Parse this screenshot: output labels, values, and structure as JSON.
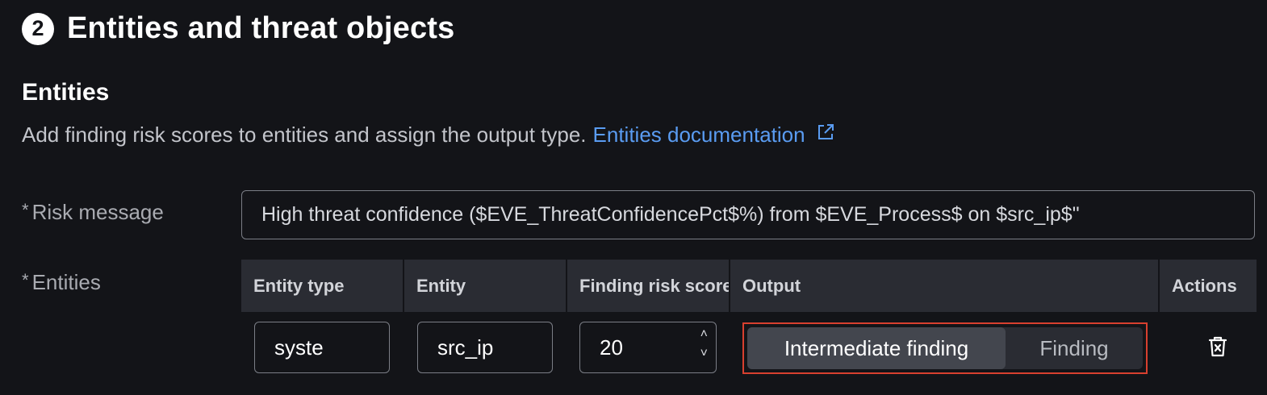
{
  "step": {
    "number": "2",
    "title": "Entities and threat objects"
  },
  "section": {
    "title": "Entities",
    "description": "Add finding risk scores to entities and assign the output type.",
    "doc_link": "Entities documentation",
    "doc_link_icon": "external-link-icon"
  },
  "risk_message": {
    "required_mark": "*",
    "label": "Risk message",
    "value": "High threat confidence ($EVE_ThreatConfidencePct$%) from $EVE_Process$ on $src_ip$\""
  },
  "entities": {
    "required_mark": "*",
    "label": "Entities",
    "columns": [
      "Entity type",
      "Entity",
      "Finding risk score",
      "Output",
      "Actions"
    ],
    "rows": [
      {
        "entity_type": "syste",
        "entity": "src_ip",
        "risk_score": "20",
        "stepper_up": "˄",
        "stepper_down": "˅",
        "output_options": [
          "Intermediate finding",
          "Finding"
        ],
        "output_selected": "Intermediate finding",
        "action_icon": "trash-icon"
      }
    ]
  },
  "colors": {
    "background": "#131418",
    "link": "#5a9cf2",
    "highlight_border": "#d8402f"
  }
}
